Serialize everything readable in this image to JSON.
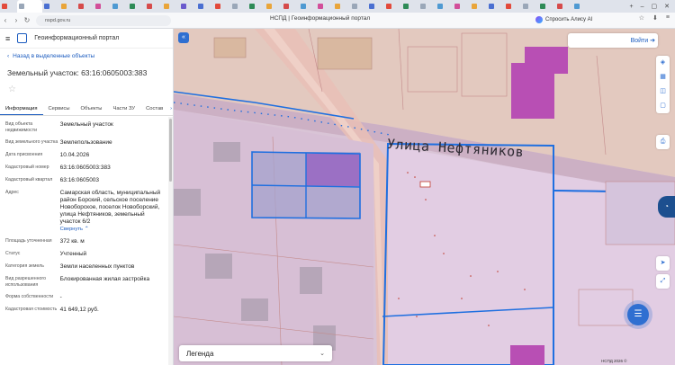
{
  "browser": {
    "tabs": [
      {
        "label": "",
        "color": "#e24a3b"
      },
      {
        "label": "",
        "color": "#9aa7b8"
      },
      {
        "label": "",
        "color": "#4a6fd1"
      },
      {
        "label": "",
        "color": "#e9a53a"
      },
      {
        "label": "",
        "color": "#d64b4b"
      },
      {
        "label": "",
        "color": "#d24f9a"
      },
      {
        "label": "",
        "color": "#4f9ad2"
      },
      {
        "label": "",
        "color": "#2e8b57"
      },
      {
        "label": "",
        "color": "#d64b4b"
      },
      {
        "label": "",
        "color": "#e9a53a"
      },
      {
        "label": "",
        "color": "#6a5acd"
      },
      {
        "label": "",
        "color": "#4a6fd1"
      },
      {
        "label": "",
        "color": "#e24a3b"
      },
      {
        "label": "",
        "color": "#9aa7b8"
      },
      {
        "label": "",
        "color": "#2e8b57"
      },
      {
        "label": "",
        "color": "#e9a53a"
      },
      {
        "label": "",
        "color": "#d64b4b"
      },
      {
        "label": "",
        "color": "#4f9ad2"
      },
      {
        "label": "",
        "color": "#d24f9a"
      },
      {
        "label": "",
        "color": "#e9a53a"
      },
      {
        "label": "",
        "color": "#9aa7b8"
      },
      {
        "label": "",
        "color": "#4a6fd1"
      },
      {
        "label": "",
        "color": "#e24a3b"
      },
      {
        "label": "",
        "color": "#2e8b57"
      },
      {
        "label": "",
        "color": "#9aa7b8"
      },
      {
        "label": "",
        "color": "#4f9ad2"
      },
      {
        "label": "",
        "color": "#d24f9a"
      },
      {
        "label": "",
        "color": "#e9a53a"
      },
      {
        "label": "",
        "color": "#4a6fd1"
      },
      {
        "label": "",
        "color": "#e24a3b"
      },
      {
        "label": "",
        "color": "#9aa7b8"
      },
      {
        "label": "",
        "color": "#2e8b57"
      },
      {
        "label": "",
        "color": "#d64b4b"
      },
      {
        "label": "",
        "color": "#4f9ad2"
      }
    ],
    "active_tab_index": 1,
    "url": "nspd.gov.ru",
    "page_title": "НСПД | Геоинформационный портал",
    "alice_label": "Спросить Алису AI"
  },
  "panel": {
    "portal_name": "Геоинформационный портал",
    "back_label": "Назад в выделенные объекты",
    "title": "Земельный участок: 63:16:0605003:383",
    "tabs": [
      "Информация",
      "Сервисы",
      "Объекты",
      "Части ЗУ",
      "Состав"
    ],
    "active_tab": 0,
    "rows": [
      {
        "key": "Вид объекта недвижимости",
        "value": "Земельный участок"
      },
      {
        "key": "Вид земельного участка",
        "value": "Землепользование"
      },
      {
        "key": "Дата присвоения",
        "value": "10.04.2026"
      },
      {
        "key": "Кадастровый номер",
        "value": "63:16:0605003:383"
      },
      {
        "key": "Кадастровый квартал",
        "value": "63:16:0605003"
      },
      {
        "key": "Адрес",
        "value": "Самарская область, муниципальный район Борский, сельское поселение Новоборское, поселок Новоборский, улица Нефтяников, земельный участок 6/2",
        "link": "Свернуть"
      },
      {
        "key": "Площадь уточненная",
        "value": "372 кв. м"
      },
      {
        "key": "Статус",
        "value": "Учтенный"
      },
      {
        "key": "Категория земель",
        "value": "Земли населенных пунктов"
      },
      {
        "key": "Вид разрешенного использования",
        "value": "Блокированная жилая застройка"
      },
      {
        "key": "Форма собственности",
        "value": "-"
      },
      {
        "key": "Кадастровая стоимость",
        "value": "41 649,12 руб."
      }
    ]
  },
  "map": {
    "login_label": "Войти",
    "street_label": "Улица Нефтяников",
    "legend_label": "Легенда",
    "copyright": "НСПД 2026 ©",
    "accent_color": "#2f6fd1",
    "parcel_border_color": "#1f6fe0"
  }
}
